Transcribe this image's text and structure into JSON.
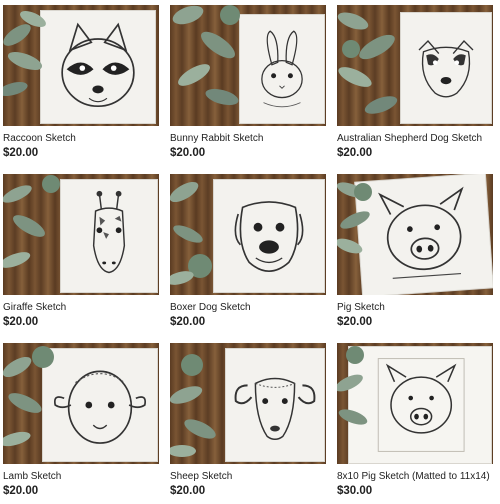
{
  "products": [
    {
      "title": "Raccoon Sketch",
      "price": "$20.00",
      "subject": "raccoon"
    },
    {
      "title": "Bunny Rabbit Sketch",
      "price": "$20.00",
      "subject": "rabbit"
    },
    {
      "title": "Australian Shepherd Dog Sketch",
      "price": "$20.00",
      "subject": "dog"
    },
    {
      "title": "Giraffe Sketch",
      "price": "$20.00",
      "subject": "giraffe"
    },
    {
      "title": "Boxer Dog Sketch",
      "price": "$20.00",
      "subject": "boxer"
    },
    {
      "title": "Pig Sketch",
      "price": "$20.00",
      "subject": "pig"
    },
    {
      "title": "Lamb Sketch",
      "price": "$20.00",
      "subject": "lamb"
    },
    {
      "title": "Sheep Sketch",
      "price": "$20.00",
      "subject": "sheep"
    },
    {
      "title": "8x10 Pig Sketch (Matted to 11x14)",
      "price": "$30.00",
      "subject": "pig-matted"
    }
  ]
}
